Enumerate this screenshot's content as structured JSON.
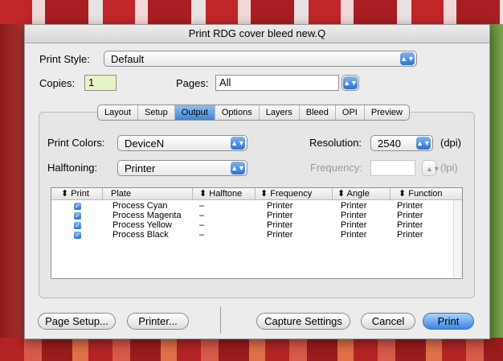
{
  "window": {
    "title": "Print RDG cover bleed new.Q"
  },
  "print_style": {
    "label": "Print Style:",
    "value": "Default"
  },
  "copies": {
    "label": "Copies:",
    "value": "1"
  },
  "pages": {
    "label": "Pages:",
    "value": "All"
  },
  "tabs": [
    {
      "label": "Layout",
      "active": false
    },
    {
      "label": "Setup",
      "active": false
    },
    {
      "label": "Output",
      "active": true
    },
    {
      "label": "Options",
      "active": false
    },
    {
      "label": "Layers",
      "active": false
    },
    {
      "label": "Bleed",
      "active": false
    },
    {
      "label": "OPI",
      "active": false
    },
    {
      "label": "Preview",
      "active": false
    }
  ],
  "print_colors": {
    "label": "Print Colors:",
    "value": "DeviceN"
  },
  "halftoning": {
    "label": "Halftoning:",
    "value": "Printer"
  },
  "resolution": {
    "label": "Resolution:",
    "value": "2540",
    "unit": "(dpi)"
  },
  "frequency": {
    "label": "Frequency:",
    "value": "",
    "unit": "(lpi)"
  },
  "table": {
    "columns": [
      "Print",
      "Plate",
      "Halftone",
      "Frequency",
      "Angle",
      "Function"
    ],
    "rows": [
      {
        "print": true,
        "plate": "Process Cyan",
        "halftone": "–",
        "frequency": "Printer",
        "angle": "Printer",
        "function": "Printer"
      },
      {
        "print": true,
        "plate": "Process Magenta",
        "halftone": "–",
        "frequency": "Printer",
        "angle": "Printer",
        "function": "Printer"
      },
      {
        "print": true,
        "plate": "Process Yellow",
        "halftone": "–",
        "frequency": "Printer",
        "angle": "Printer",
        "function": "Printer"
      },
      {
        "print": true,
        "plate": "Process Black",
        "halftone": "–",
        "frequency": "Printer",
        "angle": "Printer",
        "function": "Printer"
      }
    ]
  },
  "buttons": {
    "page_setup": "Page Setup...",
    "printer": "Printer...",
    "capture": "Capture Settings",
    "cancel": "Cancel",
    "print": "Print"
  },
  "icons": {
    "popup_arrow": "up-down-arrows-icon",
    "checkbox": "checkmark-icon",
    "sort": "sort-arrows-icon"
  }
}
